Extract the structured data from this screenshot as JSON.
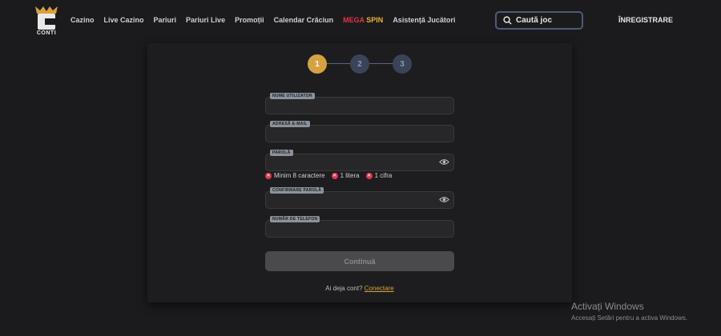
{
  "brand": {
    "logo_text": "CONTI"
  },
  "nav": {
    "items": [
      "Cazino",
      "Live Cazino",
      "Pariuri",
      "Pariuri Live",
      "Promoții",
      "Calendar Crăciun"
    ],
    "mega_part1": "MEGA",
    "mega_part2": " SPIN",
    "support": "Asistență Jucători"
  },
  "search": {
    "placeholder": "Caută joc"
  },
  "header": {
    "register_label": "ÎNREGISTRARE"
  },
  "steps": [
    "1",
    "2",
    "3"
  ],
  "form": {
    "username_label": "NUME UTILIZATOR",
    "email_label": "ADRESĂ E-MAIL",
    "password_label": "PAROLĂ",
    "confirm_label": "CONFIRMARE PAROLĂ",
    "phone_label": "NUMĂR DE TELEFON",
    "requirements": [
      "Minim 8 caractere",
      "1 litera",
      "1 cifra"
    ],
    "continue_label": "Continuă",
    "have_account": "Ai deja cont?",
    "login_link": "Conectare"
  },
  "watermark": {
    "title": "Activați Windows",
    "subtitle": "Accesați Setări pentru a activa Windows."
  },
  "colors": {
    "accent": "#d8a13f",
    "error": "#e0354d",
    "step_idle": "#3a4358"
  }
}
